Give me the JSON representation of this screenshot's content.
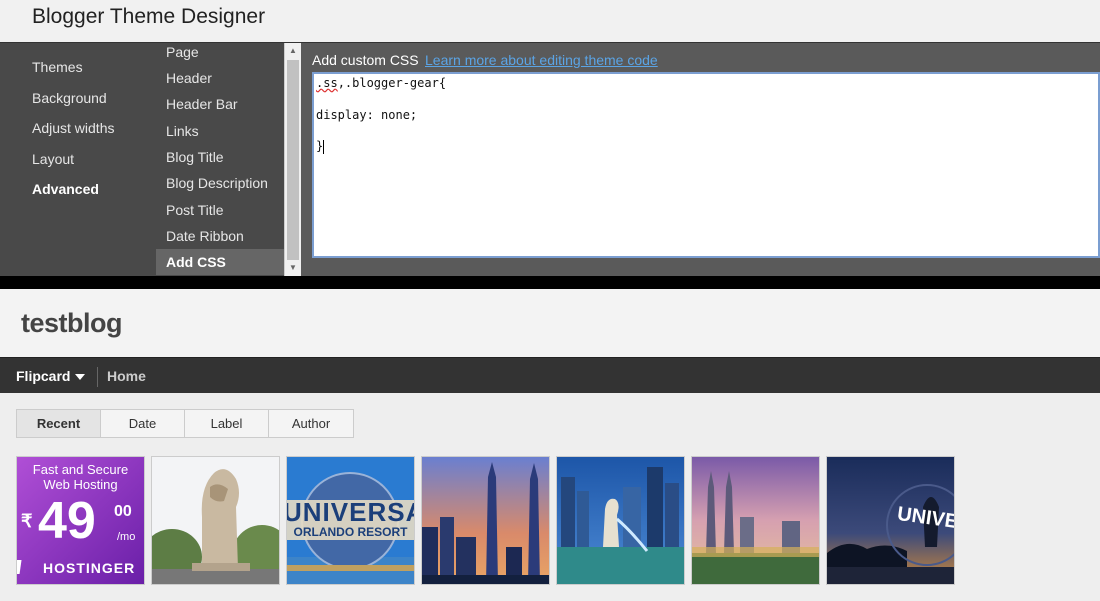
{
  "app": {
    "title": "Blogger Theme Designer"
  },
  "main_nav": [
    {
      "label": "Themes",
      "active": false
    },
    {
      "label": "Background",
      "active": false
    },
    {
      "label": "Adjust widths",
      "active": false
    },
    {
      "label": "Layout",
      "active": false
    },
    {
      "label": "Advanced",
      "active": true
    }
  ],
  "sub_nav": [
    {
      "label": "Page",
      "active": false
    },
    {
      "label": "Header",
      "active": false
    },
    {
      "label": "Header Bar",
      "active": false
    },
    {
      "label": "Links",
      "active": false
    },
    {
      "label": "Blog Title",
      "active": false
    },
    {
      "label": "Blog Description",
      "active": false
    },
    {
      "label": "Post Title",
      "active": false
    },
    {
      "label": "Date Ribbon",
      "active": false
    },
    {
      "label": "Add CSS",
      "active": true
    }
  ],
  "css_panel": {
    "label": "Add custom CSS",
    "link": "Learn more about editing theme code",
    "code": {
      "line1_spell": ".ss",
      "line1_rest": ",.blogger-gear{",
      "line2": "display: none;",
      "line3": "}"
    }
  },
  "blog": {
    "title": "testblog",
    "view_select": "Flipcard",
    "home_link": "Home",
    "tabs": [
      {
        "label": "Recent",
        "active": true
      },
      {
        "label": "Date",
        "active": false
      },
      {
        "label": "Label",
        "active": false
      },
      {
        "label": "Author",
        "active": false
      }
    ],
    "ad": {
      "line1": "Fast and Secure",
      "line2": "Web Hosting",
      "currency": "₹",
      "price": "49",
      "cents": "00",
      "per": "/mo",
      "brand": "HOSTINGER"
    },
    "globe_text": {
      "top": "UNIVERSAL",
      "bottom": "ORLANDO RESORT"
    },
    "sign_text": "UNIVE"
  },
  "colors": {
    "panel_bg": "#494949",
    "link": "#5ba4e5",
    "editor_border": "#7b9ed1",
    "ad_purple": "#8a2fc7"
  }
}
